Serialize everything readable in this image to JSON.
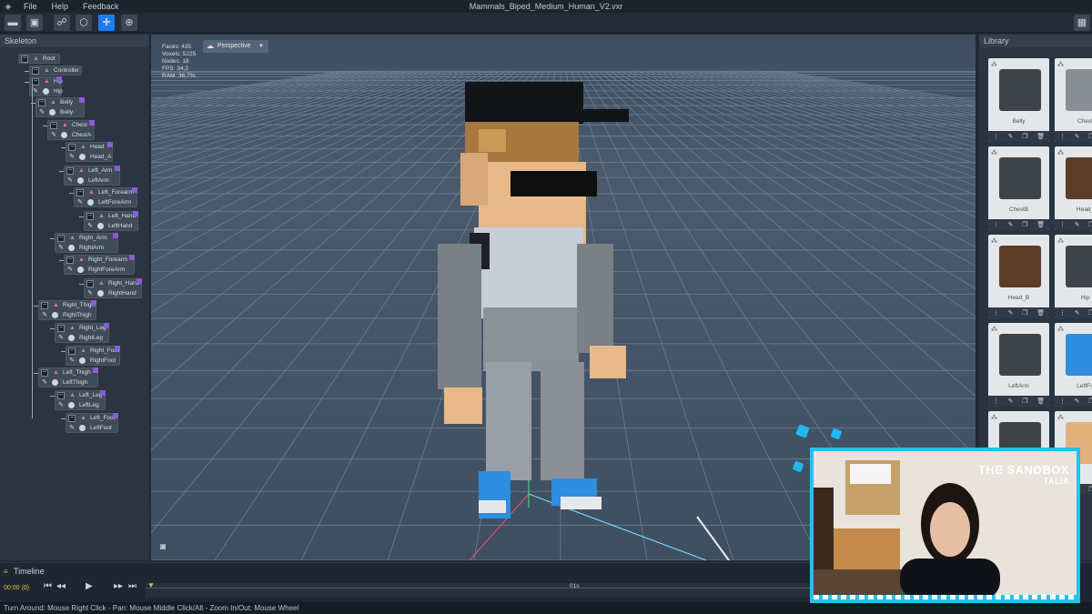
{
  "menubar": {
    "file": "File",
    "help": "Help",
    "feedback": "Feedback",
    "title": "Mammals_Biped_Medium_Human_V2.vxr"
  },
  "toolbar": {
    "icons": [
      "folder-icon",
      "save-icon",
      "skeleton-icon",
      "cube-icon",
      "move-icon",
      "target-icon"
    ],
    "active_tool": "move-icon",
    "right_icon": "library-icon"
  },
  "skeleton": {
    "title": "Skeleton",
    "nodes": [
      {
        "name": "Root",
        "bone": ""
      },
      {
        "name": "Controller",
        "bone": ""
      },
      {
        "name": "Hip",
        "bone": "Hip"
      },
      {
        "name": "Belly",
        "bone": "Belly"
      },
      {
        "name": "Chest",
        "bone": "ChestA"
      },
      {
        "name": "Head",
        "bone": "Head_A"
      },
      {
        "name": "Left_Arm",
        "bone": "LeftArm"
      },
      {
        "name": "Left_Forearm",
        "bone": "LeftForeArm"
      },
      {
        "name": "Left_Hand",
        "bone": "LeftHand"
      },
      {
        "name": "Right_Arm",
        "bone": "RightArm"
      },
      {
        "name": "Right_Forearm",
        "bone": "RightForeArm"
      },
      {
        "name": "Right_Hand",
        "bone": "RightHand"
      },
      {
        "name": "Right_Thigh",
        "bone": "RightThigh"
      },
      {
        "name": "Right_Leg",
        "bone": "RightLeg"
      },
      {
        "name": "Right_Foot",
        "bone": "RightFoot"
      },
      {
        "name": "Left_Thigh",
        "bone": "LeftThigh"
      },
      {
        "name": "Left_Leg",
        "bone": "LeftLeg"
      },
      {
        "name": "Left_Foot",
        "bone": "LeftFoot"
      }
    ]
  },
  "viewport": {
    "stats": [
      "Faces: 435",
      "Voxels: 5225",
      "Nodes: 18",
      "FPS: 34,3",
      "RAM: 36,7%"
    ],
    "camera_mode": "Perspective"
  },
  "library": {
    "title": "Library",
    "items": [
      {
        "label": "Belly"
      },
      {
        "label": "Chest"
      },
      {
        "label": "ChestB"
      },
      {
        "label": "Head_"
      },
      {
        "label": "Head_B"
      },
      {
        "label": "Hip"
      },
      {
        "label": "LeftArm"
      },
      {
        "label": "LeftFo"
      },
      {
        "label": ""
      },
      {
        "label": ""
      }
    ]
  },
  "timeline": {
    "title": "Timeline",
    "time": "00:00 (0)",
    "tick": "01s"
  },
  "statusbar": {
    "hint": "Turn Around: Mouse Right Click - Pan: Mouse Middle Click/Alt - Zoom In/Out: Mouse Wheel"
  },
  "webcam": {
    "brand": "THE SANDBOX",
    "brand_sub": "TALIA"
  },
  "colors": {
    "accent": "#1e7cf0",
    "webcam_border": "#20c3f0",
    "timeline_time": "#f3b84a"
  }
}
